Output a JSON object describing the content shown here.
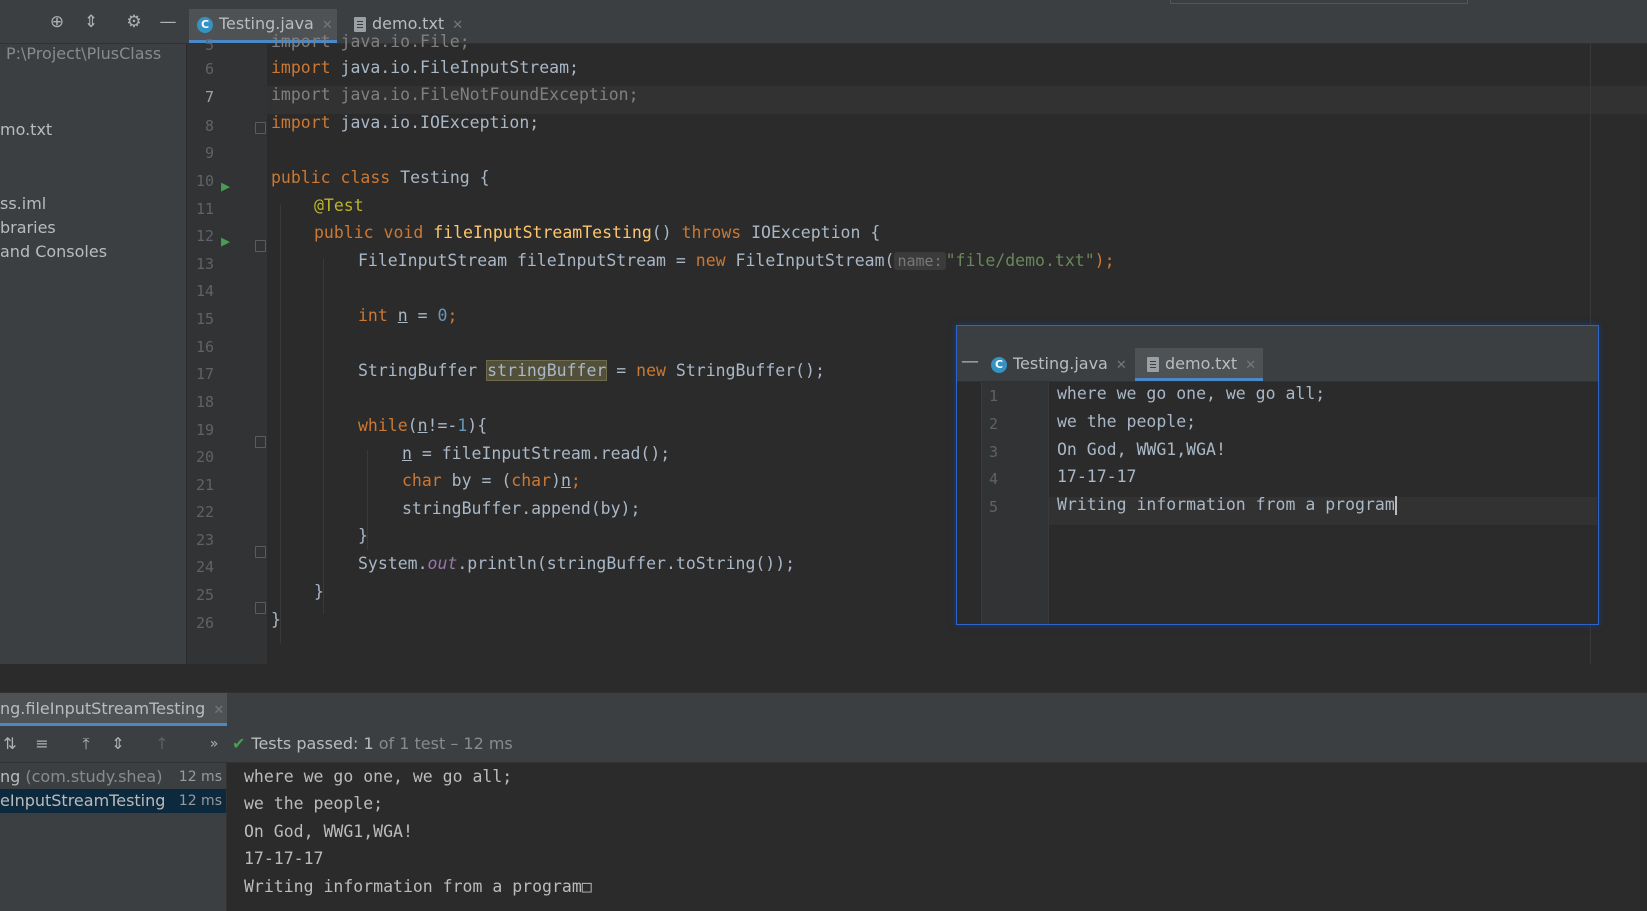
{
  "toolbar": {
    "icons": [
      "target-icon",
      "collapse-icon",
      "gear-icon",
      "minimize-icon"
    ]
  },
  "tabs": [
    {
      "label": "Testing.java",
      "icon": "java-class-icon",
      "active": true
    },
    {
      "label": "demo.txt",
      "icon": "text-file-icon",
      "active": false
    }
  ],
  "project": {
    "path": "P:\\Project\\PlusClass",
    "items": [
      "mo.txt",
      "ss.iml",
      "braries",
      "and Consoles"
    ]
  },
  "editor": {
    "line_numbers": [
      "5",
      "6",
      "7",
      "8",
      "9",
      "10",
      "11",
      "12",
      "13",
      "14",
      "15",
      "16",
      "17",
      "18",
      "19",
      "20",
      "21",
      "22",
      "23",
      "24",
      "25",
      "26"
    ],
    "lines": {
      "l5": "import java.io.File;",
      "l6_kw": "import",
      "l6_rest": " java.io.FileInputStream;",
      "l7": "import java.io.FileNotFoundException;",
      "l8_kw": "import",
      "l8_rest": " java.io.IOException;",
      "l10_kw": "public class",
      "l10_rest": " Testing {",
      "l11": "@Test",
      "l12_kw": "public void",
      "l12_fn": "fileInputStreamTesting",
      "l12_mid": "() ",
      "l12_kw2": "throws",
      "l12_rest": " IOException {",
      "l13_a": "FileInputStream fileInputStream = ",
      "l13_kw": "new",
      "l13_b": " FileInputStream(",
      "l13_hint": "name:",
      "l13_str": "\"file/demo.txt\"",
      "l13_end": ");",
      "l15_kw": "int",
      "l15_var": "n",
      "l15_eq": " = ",
      "l15_num": "0",
      "l15_end": ";",
      "l17_a": "StringBuffer ",
      "l17_var": "stringBuffer",
      "l17_b": " = ",
      "l17_kw": "new",
      "l17_c": " StringBuffer();",
      "l19_kw": "while",
      "l19_a": "(",
      "l19_var": "n",
      "l19_b": "!=-",
      "l19_num": "1",
      "l19_c": "){",
      "l20_var": "n",
      "l20_rest": " = fileInputStream.read();",
      "l21_kw": "char",
      "l21_a": " by = (",
      "l21_kw2": "char",
      "l21_b": ")",
      "l21_var": "n",
      "l21_end": ";",
      "l22": "stringBuffer.append(by);",
      "l23": "}",
      "l24_a": "System.",
      "l24_field": "out",
      "l24_b": ".println(stringBuffer.toString());",
      "l25": "}",
      "l26": "}"
    }
  },
  "popup": {
    "tabs": [
      {
        "label": "Testing.java",
        "icon": "java-class-icon"
      },
      {
        "label": "demo.txt",
        "icon": "text-file-icon",
        "active": true
      }
    ],
    "line_numbers": [
      "1",
      "2",
      "3",
      "4",
      "5"
    ],
    "lines": [
      "where we go one, we go all;",
      "we the people;",
      "On God, WWG1,WGA!",
      "17-17-17",
      "Writing information from a program"
    ]
  },
  "run": {
    "tab_label": "ng.fileInputStreamTesting",
    "status_prefix": "Tests passed: ",
    "status_count": "1",
    "status_suffix": " of 1 test – 12 ms",
    "tree": [
      {
        "label_a": "ng ",
        "label_b": "(com.study.shea)",
        "time": "12 ms",
        "selected": false
      },
      {
        "label_a": "eInputStreamTesting",
        "label_b": "",
        "time": "12 ms",
        "selected": true
      }
    ],
    "console": [
      "where we go one, we go all;",
      "we the people;",
      "On God, WWG1,WGA!",
      "17-17-17",
      "Writing information from a program□"
    ]
  },
  "colors": {
    "accent": "#4a88c7",
    "keyword": "#cc7832",
    "string": "#6a8759",
    "number": "#6897bb",
    "annotation": "#bbb529",
    "method": "#ffc66d",
    "pass": "#499c54"
  }
}
